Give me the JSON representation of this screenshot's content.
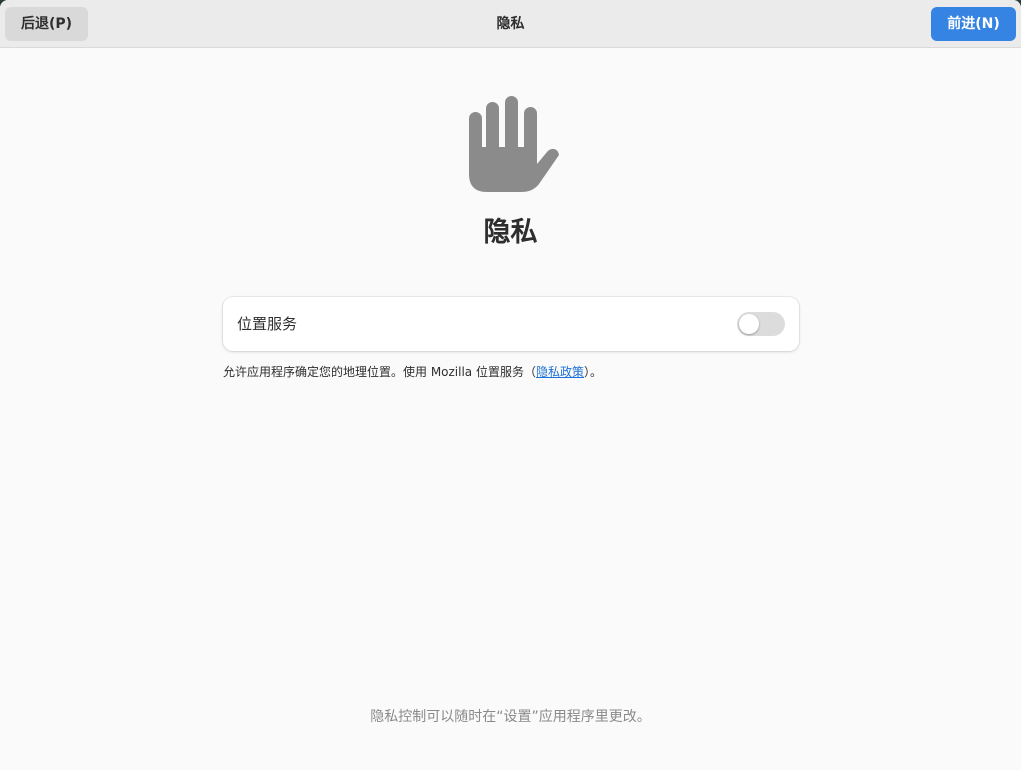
{
  "window": {
    "title": "隐私"
  },
  "headerbar": {
    "back_label": "后退(P)",
    "next_label": "前进(N)",
    "title": "隐私"
  },
  "page": {
    "icon": "hand-stop-icon",
    "heading": "隐私"
  },
  "location_services": {
    "label": "位置服务",
    "enabled": false
  },
  "description": {
    "text_before": "允许应用程序确定您的地理位置。使用 Mozilla 位置服务（",
    "link_text": "隐私政策",
    "text_after": "）。"
  },
  "footer": {
    "text": "隐私控制可以随时在“设置”应用程序里更改。"
  },
  "colors": {
    "accent": "#3584e4",
    "link": "#1c71d8",
    "icon_gray": "#8b8b8b",
    "switch_off": "#dcdcdc"
  }
}
